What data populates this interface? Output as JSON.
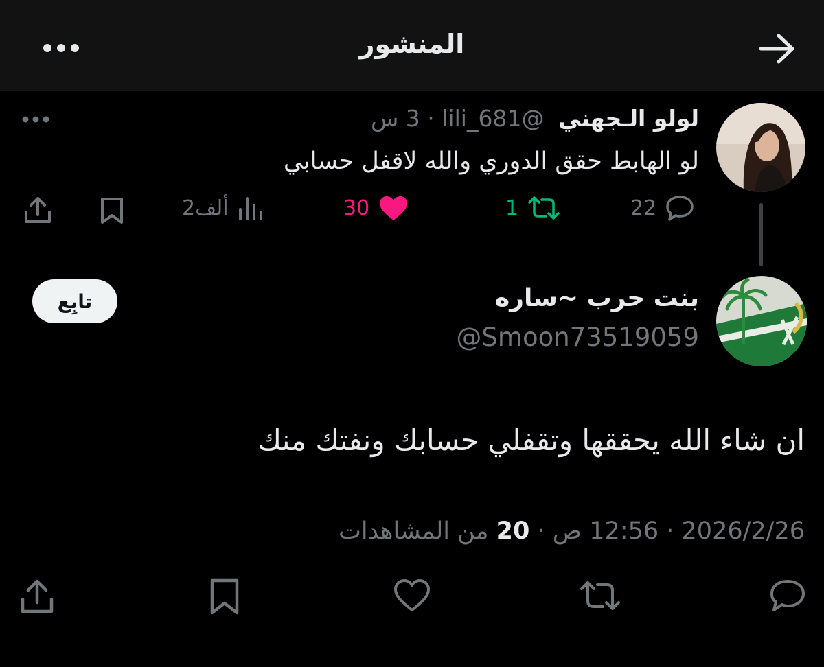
{
  "header": {
    "title": "المنشور"
  },
  "parent_tweet": {
    "name": "لولو الـجهني",
    "handle": "@lili_681",
    "separator": "·",
    "time": "3 س",
    "text": "لو الهابط حقق الدوري والله لاقفل حسابي",
    "replies": "22",
    "retweets": "1",
    "likes": "30",
    "views": "2ألف",
    "colors": {
      "retweet": "#00ba7c",
      "like": "#f91880",
      "muted": "#71767b"
    }
  },
  "main_tweet": {
    "name": "بنت حرب ~ساره",
    "handle": "@Smoon73519059",
    "follow_label": "تابِع",
    "text": "ان شاء الله يحققها وتقفلي حسابك ونفتك منك",
    "date": "2026/2/26",
    "time": "12:56 ص",
    "sep": "·",
    "views_count": "20",
    "views_label": "من المشاهدات"
  }
}
